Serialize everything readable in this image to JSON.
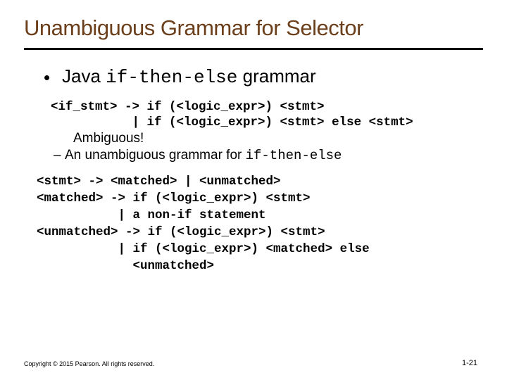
{
  "title": "Unambiguous Grammar for Selector",
  "bullet1_pre": "Java ",
  "bullet1_code": "if-then-else",
  "bullet1_post": " grammar",
  "grammar1_line1": "<if_stmt> -> if (<logic_expr>) <stmt>",
  "grammar1_line2": "           | if (<logic_expr>) <stmt> else <stmt>",
  "ambiguous": "Ambiguous!",
  "sub_pre": "An unambiguous grammar for ",
  "sub_code": "if-then-else",
  "grammar2_line1": "<stmt> -> <matched> | <unmatched>",
  "grammar2_line2": "<matched> -> if (<logic_expr>) <stmt>",
  "grammar2_line3": "           | a non-if statement",
  "grammar2_line4": "<unmatched> -> if (<logic_expr>) <stmt>",
  "grammar2_line5": "           | if (<logic_expr>) <matched> else",
  "grammar2_line6": "             <unmatched>",
  "copyright": "Copyright © 2015 Pearson. All rights reserved.",
  "pagenum": "1-21"
}
